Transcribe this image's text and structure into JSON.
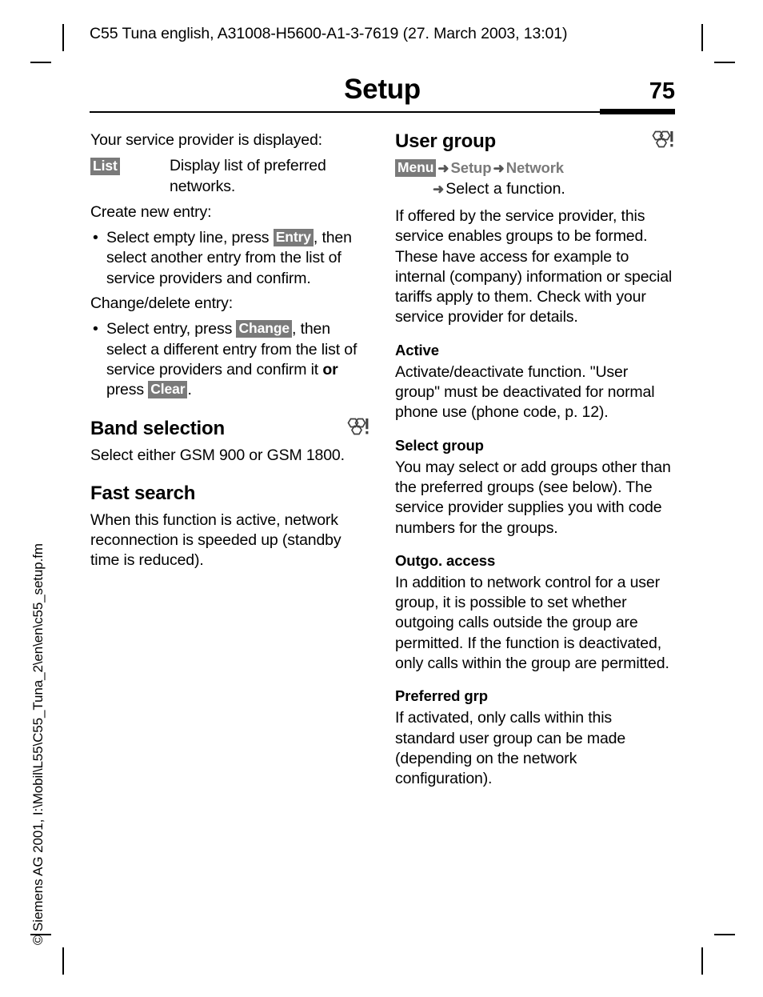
{
  "document": {
    "running_head": "C55 Tuna english, A31008-H5600-A1-3-7619 (27. March 2003, 13:01)",
    "chapter_title": "Setup",
    "page_number": "75",
    "spine_note": "© Siemens AG 2001, I:\\Mobil\\L55\\C55_Tuna_2\\en\\en\\c55_setup.fm"
  },
  "colors": {
    "keycap_bg": "#7a7a7a",
    "keycap_fg": "#ffffff",
    "crumb_grey": "#7a7a7a",
    "rule": "#000000"
  },
  "left_column": {
    "intro": "Your service provider is displayed:",
    "list_entry": {
      "key": "List",
      "description": "Display list of preferred networks."
    },
    "create_label": "Create new entry:",
    "create_bullet": {
      "dot": "•",
      "part1": "Select empty line, press ",
      "key": "Entry",
      "part2": ", then select another entry from the list of service providers and confirm."
    },
    "change_label": "Change/delete entry:",
    "change_bullet": {
      "dot": "•",
      "part1": "Select entry, press ",
      "key1": "Change",
      "part2": ", then select a different entry from the list of service providers and confirm it ",
      "emphasis": "or",
      "part3": " press ",
      "key2": "Clear",
      "part4": "."
    },
    "band_selection": {
      "heading": "Band selection",
      "picto": "user-group-picto",
      "body": "Select either GSM 900 or GSM 1800."
    },
    "fast_search": {
      "heading": "Fast search",
      "body": "When this function is active, network reconnection is speeded up (standby time is reduced)."
    }
  },
  "right_column": {
    "user_group": {
      "heading": "User group",
      "picto": "user-group-picto",
      "breadcrumb": {
        "key": "Menu",
        "arrow": "➜",
        "step1": "Setup",
        "step2": "Network",
        "step3": "Select a function."
      },
      "body": "If offered by the service provider, this service enables groups to be formed. These have access for example to internal (company) information or special tariffs apply to them. Check with your service provider for details."
    },
    "active": {
      "heading": "Active",
      "body": "Activate/deactivate function. \"User group\" must be deactivated for normal phone use (phone code, p. 12)."
    },
    "select_group": {
      "heading": "Select group",
      "body": "You may select or add groups other than the preferred groups (see below). The service provider supplies you with code numbers for the groups."
    },
    "outgo_access": {
      "heading": "Outgo. access",
      "body": "In addition to network control for a user group, it is possible to set whether outgoing calls outside the group are permitted. If the function is deactivated, only calls within the group are permitted."
    },
    "preferred_grp": {
      "heading": "Preferred grp",
      "body": "If activated, only calls within this standard user group can be made (depending on the network configuration)."
    }
  }
}
